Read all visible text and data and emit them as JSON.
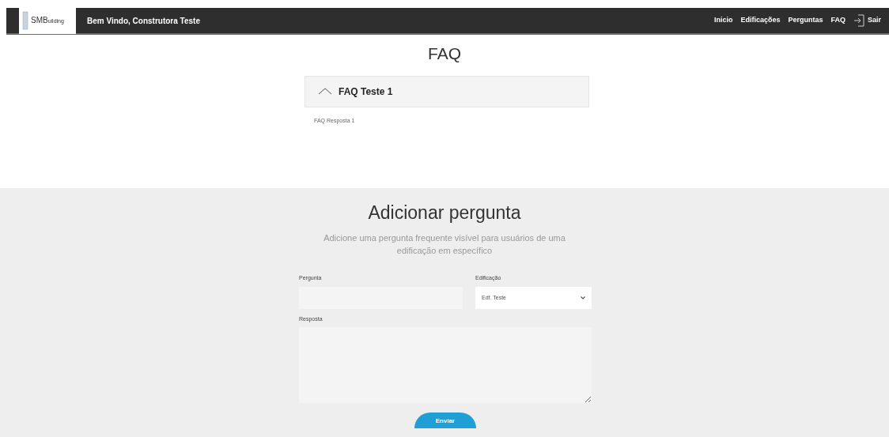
{
  "navbar": {
    "logo": {
      "main": "SMB",
      "sub": "uilding"
    },
    "greeting": "Bem Vindo, Construtora Teste",
    "links": [
      {
        "label": "Inicio",
        "kind": "link"
      },
      {
        "label": "Edificações",
        "kind": "link"
      },
      {
        "label": "Perguntas",
        "kind": "link"
      },
      {
        "label": "FAQ",
        "kind": "link"
      },
      {
        "label": "Sair",
        "kind": "logout"
      }
    ]
  },
  "faq": {
    "title": "FAQ",
    "items": [
      {
        "question": "FAQ Teste 1",
        "answer": "FAQ Resposta 1",
        "expanded": true
      }
    ]
  },
  "form": {
    "title": "Adicionar pergunta",
    "subtitle": "Adicione uma pergunta frequente visível para usuários de uma edificação em específico",
    "fields": {
      "question_label": "Pergunta",
      "building_label": "Edificação",
      "building_value": "Edf. Teste",
      "answer_label": "Resposta"
    },
    "submit": "Enviar"
  }
}
